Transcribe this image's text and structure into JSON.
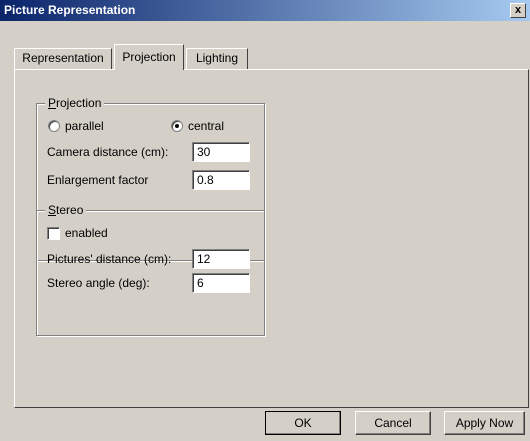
{
  "window": {
    "title": "Picture Representation",
    "close_label": "x"
  },
  "tabs": [
    {
      "label": "Representation",
      "active": false
    },
    {
      "label": "Projection",
      "active": true
    },
    {
      "label": "Lighting",
      "active": false
    }
  ],
  "projection": {
    "group_title_first": "P",
    "group_title_rest": "rojection",
    "parallel_label": "parallel",
    "central_label": "central",
    "selected": "central",
    "camera_distance_label": "Camera distance (cm):",
    "camera_distance_value": "30",
    "enlargement_label": "Enlargement factor",
    "enlargement_value": "0.8"
  },
  "stereo": {
    "group_title_first": "S",
    "group_title_rest": "tereo",
    "enabled_label": "enabled",
    "enabled": false,
    "pictures_distance_label": "Pictures' distance (cm):",
    "pictures_distance_value": "12",
    "stereo_angle_label": "Stereo angle (deg):",
    "stereo_angle_value": "6"
  },
  "buttons": {
    "ok": "OK",
    "cancel": "Cancel",
    "apply": "Apply Now"
  }
}
